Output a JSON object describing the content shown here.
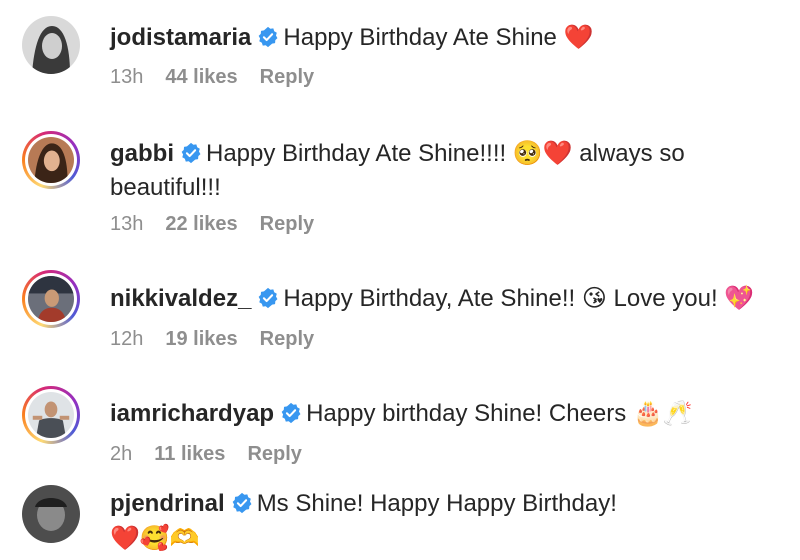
{
  "colors": {
    "verified_badge": "#3897f0",
    "text": "#262626",
    "meta": "#8e8e8e",
    "heart": "#e0245e"
  },
  "comments": [
    {
      "username": "jodistamaria",
      "verified": true,
      "text": "Happy Birthday Ate Shine",
      "emoji": "❤️",
      "time": "13h",
      "likes": "44 likes",
      "reply": "Reply"
    },
    {
      "username": "gabbi",
      "verified": true,
      "text": "Happy Birthday Ate Shine!!!!",
      "emoji": "🥺❤️",
      "text_after": "always so beautiful!!!",
      "time": "13h",
      "likes": "22 likes",
      "reply": "Reply"
    },
    {
      "username": "nikkivaldez_",
      "verified": true,
      "text": "Happy Birthday, Ate Shine!!",
      "emoji": "😘",
      "text_after": "Love you!",
      "emoji_end": "💖",
      "time": "12h",
      "likes": "19 likes",
      "reply": "Reply"
    },
    {
      "username": "iamrichardyap",
      "verified": true,
      "text": "Happy birthday Shine! Cheers",
      "emoji": "🎂🥂",
      "time": "2h",
      "likes": "11 likes",
      "reply": "Reply"
    },
    {
      "username": "pjendrinal",
      "verified": true,
      "text": "Ms Shine! Happy Happy Birthday!",
      "emoji": "❤️🥰🫶",
      "time": "",
      "likes": "",
      "reply": ""
    }
  ]
}
